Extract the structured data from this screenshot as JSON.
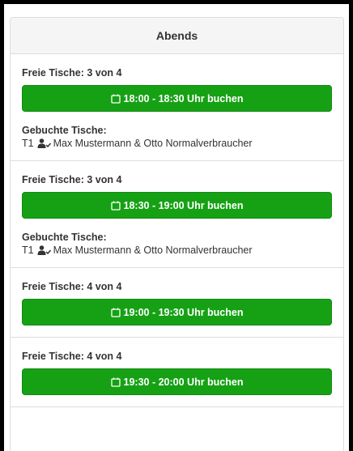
{
  "panel": {
    "title": "Abends"
  },
  "slots": [
    {
      "free": "Freie Tische: 3 von 4",
      "button": "18:00 - 18:30 Uhr buchen",
      "booked_label": "Gebuchte Tische:",
      "table": "T1",
      "guests": "Max Mustermann & Otto Normalverbraucher"
    },
    {
      "free": "Freie Tische: 3 von 4",
      "button": "18:30 - 19:00 Uhr buchen",
      "booked_label": "Gebuchte Tische:",
      "table": "T1",
      "guests": "Max Mustermann & Otto Normalverbraucher"
    },
    {
      "free": "Freie Tische: 4 von 4",
      "button": "19:00 - 19:30 Uhr buchen"
    },
    {
      "free": "Freie Tische: 4 von 4",
      "button": "19:30 - 20:00 Uhr buchen"
    }
  ],
  "icons": {
    "button_icon": "calendar-icon",
    "booking_icon": "user-check-icon"
  },
  "colors": {
    "button": "#16a115",
    "heading_bg": "#f5f5f5",
    "border": "#dddddd"
  }
}
